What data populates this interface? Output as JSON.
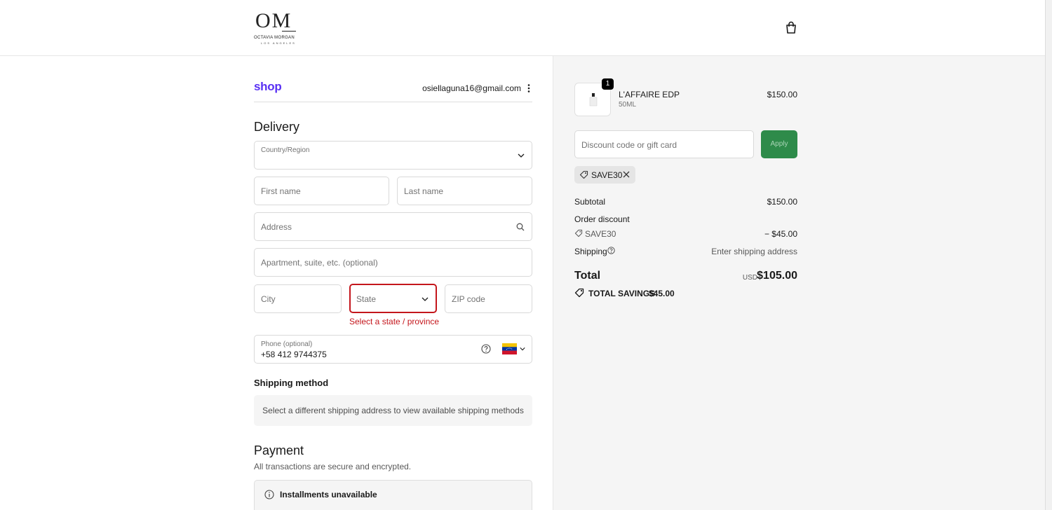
{
  "header": {
    "logo_mark": "OM",
    "logo_name": "OCTAVIA MORGAN",
    "logo_sub": "LOS ANGELES",
    "cart_icon": "shopping-bag-icon"
  },
  "account": {
    "shop_logo": "shop",
    "email": "osiellaguna16@gmail.com"
  },
  "delivery": {
    "heading": "Delivery",
    "country_label": "Country/Region",
    "first_name_placeholder": "First name",
    "last_name_placeholder": "Last name",
    "address_placeholder": "Address",
    "apartment_placeholder": "Apartment, suite, etc. (optional)",
    "city_placeholder": "City",
    "state_placeholder": "State",
    "zip_placeholder": "ZIP code",
    "state_error": "Select a state / province",
    "phone_label": "Phone (optional)",
    "phone_value": "+58 412 9744375"
  },
  "shipping_method": {
    "heading": "Shipping method",
    "message": "Select a different shipping address to view available shipping methods"
  },
  "payment": {
    "heading": "Payment",
    "subtitle": "All transactions are secure and encrypted.",
    "notice_title": "Installments unavailable"
  },
  "order": {
    "item_name": "L'AFFAIRE EDP",
    "item_variant": "50ML",
    "item_qty": "1",
    "item_price": "$150.00",
    "discount_placeholder": "Discount code or gift card",
    "apply_label": "Apply",
    "applied_code": "SAVE30",
    "subtotal_label": "Subtotal",
    "subtotal_value": "$150.00",
    "order_discount_label": "Order discount",
    "discount_code": "SAVE30",
    "discount_value": "− $45.00",
    "shipping_label": "Shipping",
    "shipping_value": "Enter shipping address",
    "total_label": "Total",
    "currency": "USD",
    "total_value": "$105.00",
    "savings_label": "TOTAL SAVINGS",
    "savings_value": "$45.00"
  },
  "colors": {
    "shop_purple": "#5a31f4",
    "apply_green": "#2e8b4a",
    "error_red": "#c4161c"
  }
}
